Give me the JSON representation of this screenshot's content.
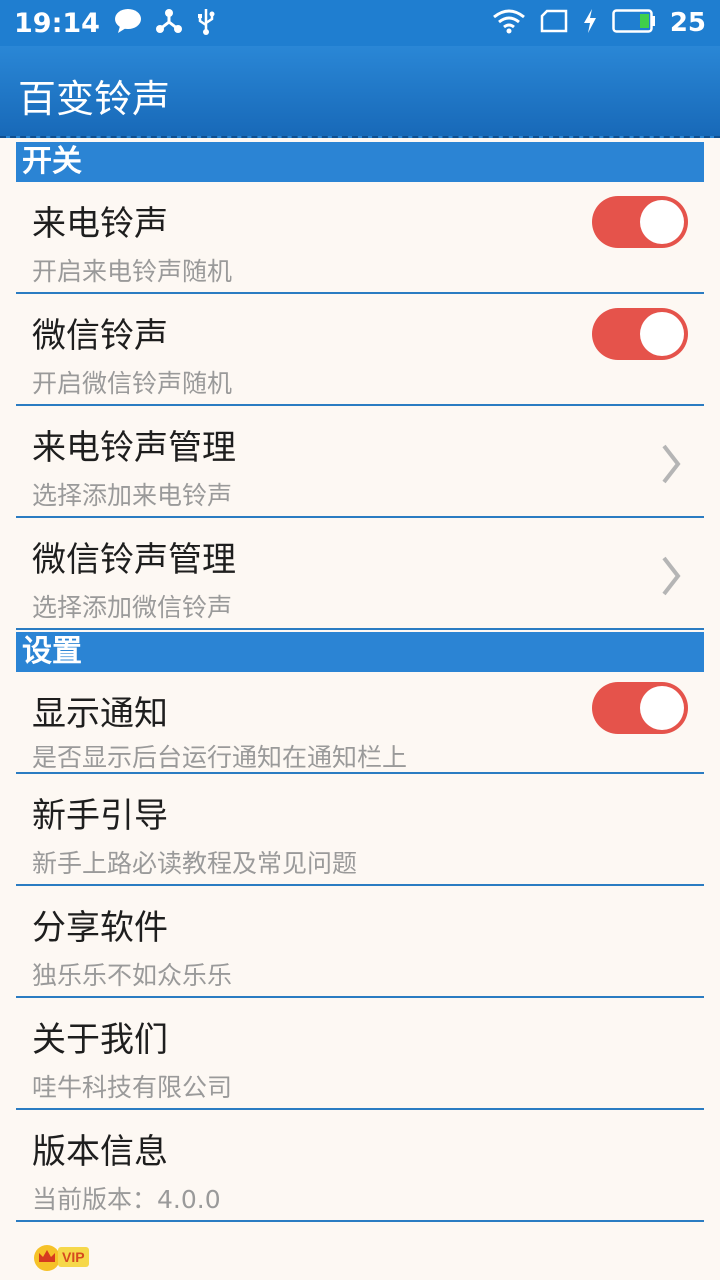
{
  "status_bar": {
    "time": "19:14",
    "battery": "25",
    "icons": [
      "message-icon",
      "share-icon",
      "usb-icon",
      "wifi-icon",
      "sim-icon",
      "charging-icon",
      "battery-icon"
    ]
  },
  "app": {
    "title": "百变铃声"
  },
  "sections": {
    "switches": {
      "label": "开关"
    },
    "settings": {
      "label": "设置"
    }
  },
  "rows": {
    "incoming": {
      "title": "来电铃声",
      "subtitle": "开启来电铃声随机",
      "toggle_on": true
    },
    "wechat": {
      "title": "微信铃声",
      "subtitle": "开启微信铃声随机",
      "toggle_on": true
    },
    "incoming_manage": {
      "title": "来电铃声管理",
      "subtitle": "选择添加来电铃声"
    },
    "wechat_manage": {
      "title": "微信铃声管理",
      "subtitle": "选择添加微信铃声"
    },
    "notify": {
      "title": "显示通知",
      "subtitle": "是否显示后台运行通知在通知栏上",
      "toggle_on": true
    },
    "guide": {
      "title": "新手引导",
      "subtitle": "新手上路必读教程及常见问题"
    },
    "share": {
      "title": "分享软件",
      "subtitle": "独乐乐不如众乐乐"
    },
    "about": {
      "title": "关于我们",
      "subtitle": "哇牛科技有限公司"
    },
    "version": {
      "title": "版本信息",
      "subtitle": "当前版本：4.0.0"
    }
  },
  "vip": {
    "label": "VIP"
  },
  "colors": {
    "primary": "#2b84d4",
    "toggle_on": "#e5534b",
    "divider": "#2b7cc2",
    "background": "#fdf8f3"
  }
}
